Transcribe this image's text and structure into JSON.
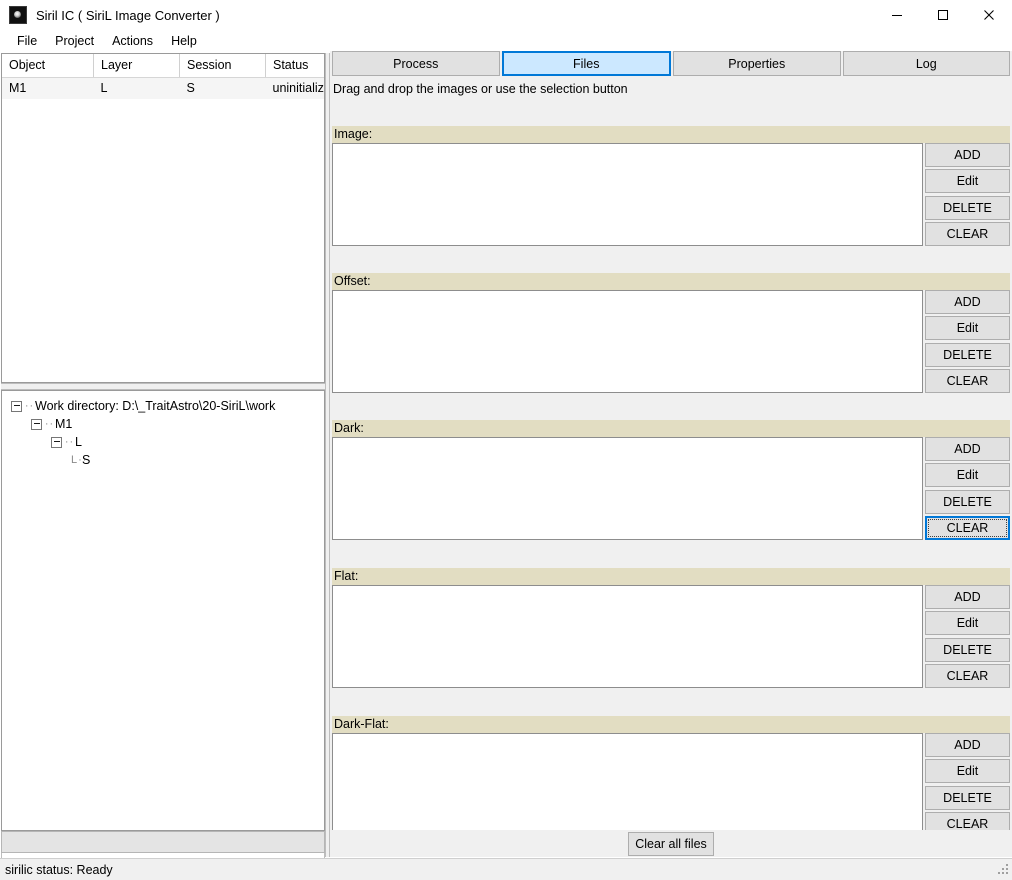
{
  "window": {
    "title": "Siril IC  ( SiriL Image Converter )",
    "icon": "siril-app-icon",
    "controls": {
      "minimize": "minimize-icon",
      "maximize": "maximize-icon",
      "close": "close-icon"
    }
  },
  "menubar": {
    "items": [
      {
        "label": "File"
      },
      {
        "label": "Project"
      },
      {
        "label": "Actions"
      },
      {
        "label": "Help"
      }
    ]
  },
  "object_table": {
    "columns": [
      "Object",
      "Layer",
      "Session",
      "Status"
    ],
    "rows": [
      {
        "object": "M1",
        "layer": "L",
        "session": "S",
        "status": "uninitialized"
      }
    ]
  },
  "tree": {
    "nodes": [
      {
        "level": 0,
        "label": "Work directory: D:\\_TraitAstro\\20-SiriL\\work",
        "expander": true
      },
      {
        "level": 1,
        "label": "M1",
        "expander": true
      },
      {
        "level": 2,
        "label": "L",
        "expander": true
      },
      {
        "level": 3,
        "label": "S",
        "expander": false
      }
    ]
  },
  "left_bottom": {
    "dots": "..."
  },
  "tabs": [
    {
      "label": "Process",
      "active": false
    },
    {
      "label": "Files",
      "active": true
    },
    {
      "label": "Properties",
      "active": false
    },
    {
      "label": "Log",
      "active": false
    }
  ],
  "files_pane": {
    "hint": "Drag and drop the images or use the selection button",
    "clear_all_label": "Clear all files",
    "sections": [
      {
        "title": "Image:",
        "items": [],
        "buttons": [
          "ADD",
          "Edit",
          "DELETE",
          "CLEAR"
        ],
        "focused_button": null
      },
      {
        "title": "Offset:",
        "items": [],
        "buttons": [
          "ADD",
          "Edit",
          "DELETE",
          "CLEAR"
        ],
        "focused_button": null
      },
      {
        "title": "Dark:",
        "items": [],
        "buttons": [
          "ADD",
          "Edit",
          "DELETE",
          "CLEAR"
        ],
        "focused_button": "CLEAR"
      },
      {
        "title": "Flat:",
        "items": [],
        "buttons": [
          "ADD",
          "Edit",
          "DELETE",
          "CLEAR"
        ],
        "focused_button": null
      },
      {
        "title": "Dark-Flat:",
        "items": [],
        "buttons": [
          "ADD",
          "Edit",
          "DELETE",
          "CLEAR"
        ],
        "focused_button": null
      }
    ]
  },
  "statusbar": {
    "text": "sirilic status: Ready"
  },
  "colors": {
    "accent": "#0078d7",
    "tab_active_bg": "#cce8ff",
    "section_header_bg": "#e2ddc2",
    "panel_bg": "#f0f0f0",
    "button_bg": "#e1e1e1"
  }
}
